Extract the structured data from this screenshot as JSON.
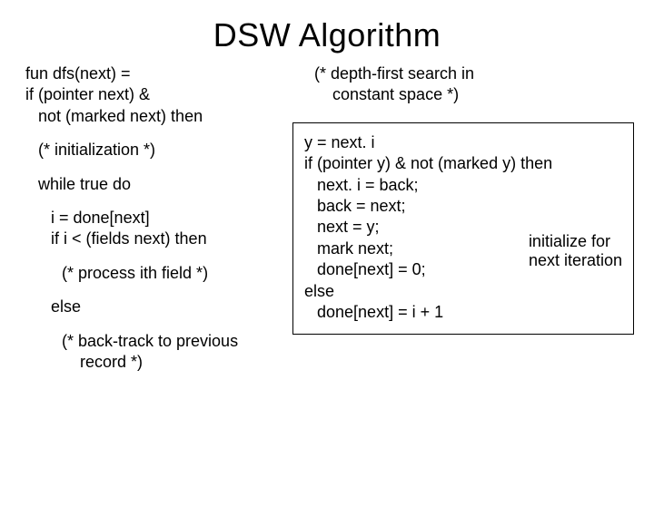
{
  "title": "DSW Algorithm",
  "left": {
    "l1": "fun dfs(next) =",
    "l2": "if (pointer next) &",
    "l3": "not (marked next) then",
    "init": "(* initialization *)",
    "while": "while true do",
    "i1": "i = done[next]",
    "i2": "if i < (fields next) then",
    "process": "(* process ith field *)",
    "else": "else",
    "back1": "(* back-track to previous",
    "back2": "record *)"
  },
  "right": {
    "c1": "(* depth-first search in",
    "c2": "constant space *)",
    "b1": "y = next. i",
    "b2": "if (pointer y) & not (marked y) then",
    "b3": "next. i = back;",
    "b4": "back = next;",
    "b5": "next = y;",
    "b6": "mark next;",
    "b7": "done[next] = 0;",
    "b8": "else",
    "b9": "done[next] = i + 1",
    "annot1": "initialize for",
    "annot2": "next iteration"
  }
}
